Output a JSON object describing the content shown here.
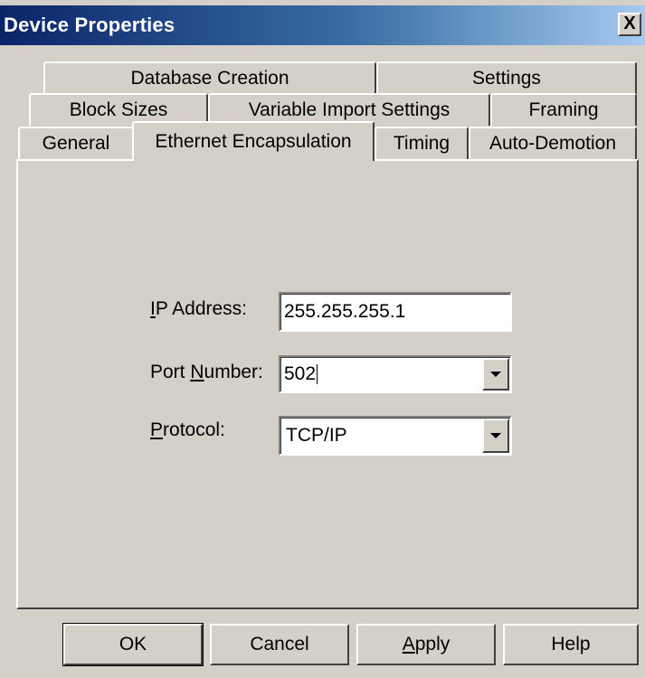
{
  "window": {
    "title": "Device Properties",
    "close_label": "X"
  },
  "tabs": {
    "row1": [
      {
        "label": "Database Creation"
      },
      {
        "label": "Settings"
      }
    ],
    "row2": [
      {
        "label": "Block Sizes"
      },
      {
        "label": "Variable Import Settings"
      },
      {
        "label": "Framing"
      }
    ],
    "row3": [
      {
        "label": "General"
      },
      {
        "label": "Ethernet Encapsulation"
      },
      {
        "label": "Timing"
      },
      {
        "label": "Auto-Demotion"
      }
    ],
    "active": "Ethernet Encapsulation"
  },
  "form": {
    "ip": {
      "label_prefix": "",
      "label_mnemonic": "I",
      "label_rest": "P Address:",
      "value": "255.255.255.1"
    },
    "port": {
      "label_prefix": "Port ",
      "label_mnemonic": "N",
      "label_rest": "umber:",
      "value": "502"
    },
    "protocol": {
      "label_prefix": "",
      "label_mnemonic": "P",
      "label_rest": "rotocol:",
      "value": "TCP/IP"
    }
  },
  "buttons": {
    "ok": "OK",
    "cancel": "Cancel",
    "apply_mnemonic": "A",
    "apply_rest": "pply",
    "help": "Help"
  }
}
